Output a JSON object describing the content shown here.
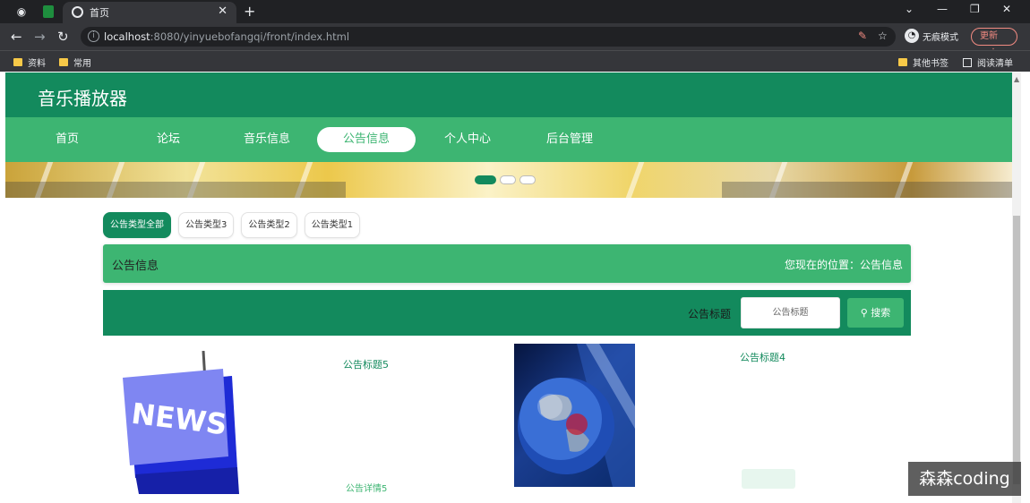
{
  "browser": {
    "tab_title": "首页",
    "url_host": "localhost",
    "url_rest": ":8080/yinyuebofangqi/front/index.html",
    "profile_label": "无痕模式",
    "update_label": "更新",
    "bookmarks": [
      "资料",
      "常用"
    ],
    "bookmarks_right": [
      "其他书签",
      "阅读清单"
    ],
    "icons": [
      "back-icon",
      "forward-icon",
      "reload-icon",
      "star-icon",
      "minimize-icon",
      "maximize-icon",
      "close-icon"
    ]
  },
  "site": {
    "title": "音乐播放器",
    "nav": [
      "首页",
      "论坛",
      "音乐信息",
      "公告信息",
      "个人中心",
      "后台管理"
    ],
    "active_nav": "公告信息",
    "accent": "#138a5d",
    "accent_light": "#3db572"
  },
  "filters": [
    "公告类型全部",
    "公告类型3",
    "公告类型2",
    "公告类型1"
  ],
  "crumb": {
    "title": "公告信息",
    "location": "您现在的位置：公告信息"
  },
  "search": {
    "label": "公告标题",
    "placeholder": "公告标题",
    "button": "搜索"
  },
  "cards": [
    {
      "title": "公告标题5",
      "link": "公告详情5",
      "image": "NEWS"
    },
    {
      "title": "公告标题4"
    }
  ],
  "watermark": "森森coding"
}
